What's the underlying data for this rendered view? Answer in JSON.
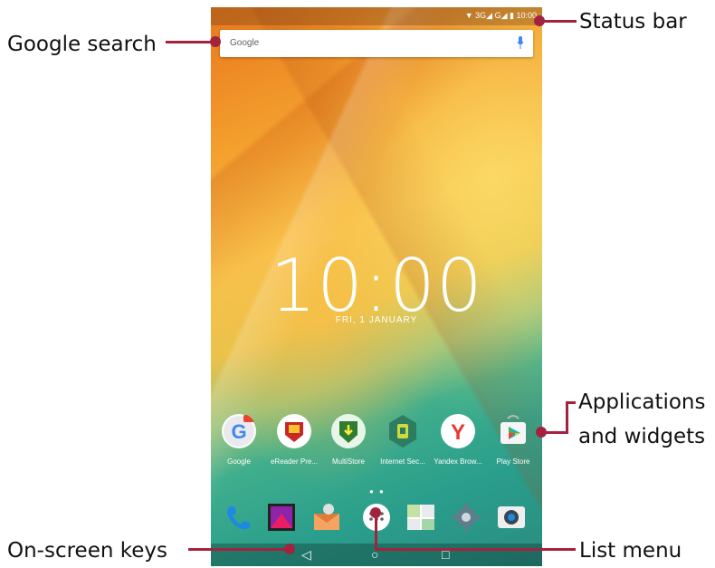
{
  "callouts": {
    "status_bar": "Status bar",
    "google_search": "Google search",
    "apps_line1": "Applications",
    "apps_line2": "and widgets",
    "onscreen_keys": "On-screen keys",
    "list_menu": "List menu"
  },
  "status": {
    "text": "▼ 3G◢ G◢ ▮ 10:00"
  },
  "search": {
    "logo": "Google"
  },
  "lockscreen": {
    "time": "10:00",
    "date": "FRI, 1 JANUARY"
  },
  "apps": [
    {
      "label": "Google",
      "icon": "google-icon",
      "color": "#e84335"
    },
    {
      "label": "eReader Pre...",
      "icon": "ereader-icon",
      "color": "#c62828"
    },
    {
      "label": "MultiStore",
      "icon": "multistore-icon",
      "color": "#2e7d32"
    },
    {
      "label": "Internet Sec...",
      "icon": "internet-security-icon",
      "color": "#43a047"
    },
    {
      "label": "Yandex Brow...",
      "icon": "yandex-browser-icon",
      "color": "#e53935"
    },
    {
      "label": "Play Store",
      "icon": "play-store-icon",
      "color": "#ffffff"
    }
  ],
  "page_dots": "● ●",
  "dock": [
    {
      "icon": "phone-icon"
    },
    {
      "icon": "gallery-icon"
    },
    {
      "icon": "email-icon"
    },
    {
      "icon": "app-drawer-icon"
    },
    {
      "icon": "maps-icon"
    },
    {
      "icon": "settings-icon"
    },
    {
      "icon": "camera-icon"
    }
  ],
  "navkeys": {
    "back": "◁",
    "home": "○",
    "recents": "□"
  },
  "colors": {
    "accent": "#a3233f"
  }
}
